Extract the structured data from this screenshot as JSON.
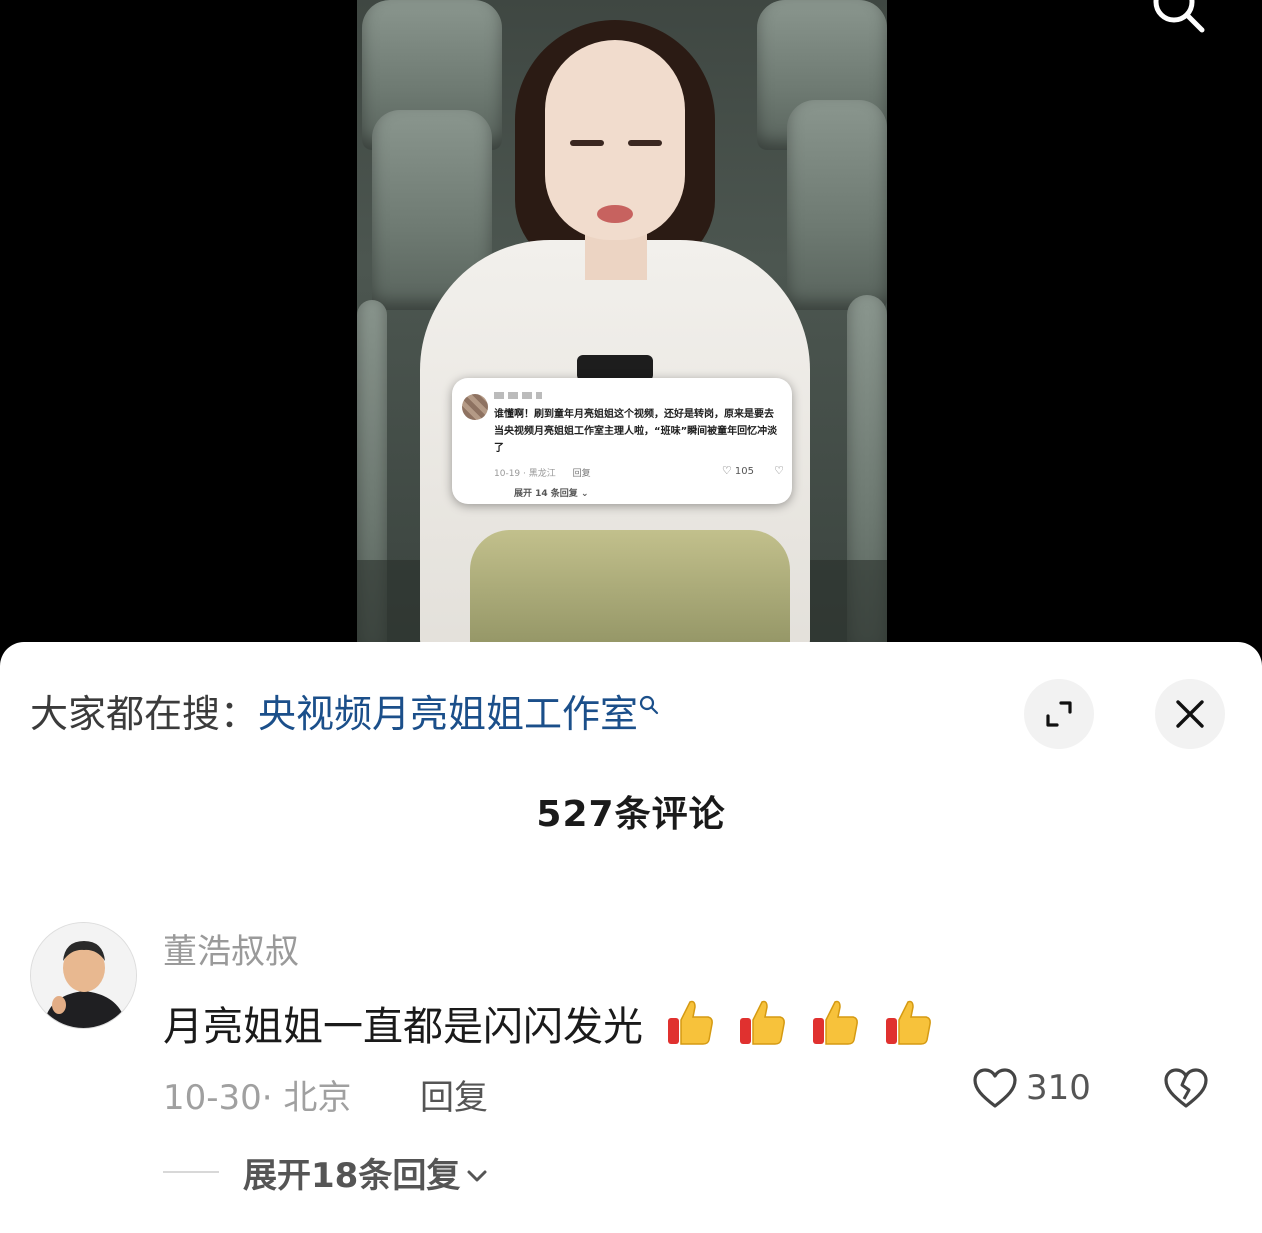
{
  "video": {
    "embedded_comment": {
      "text": "谁懂啊！刷到童年月亮姐姐这个视频，还好是转岗，原来是要去当央视频月亮姐姐工作室主理人啦，“班味”瞬间被童年回忆冲淡了",
      "date_location": "10-19 · 黑龙江",
      "reply_label": "回复",
      "like_count": "105",
      "expand_label": "展开 14 条回复"
    }
  },
  "sheet": {
    "search_prefix": "大家都在搜：",
    "search_term": "央视频月亮姐姐工作室",
    "comment_count": "527条评论"
  },
  "comment": {
    "author": "董浩叔叔",
    "text": "月亮姐姐一直都是闪闪发光",
    "date": "10-30",
    "location": "· 北京",
    "reply_label": "回复",
    "like_count": "310",
    "expand_replies": "展开18条回复"
  },
  "icons": [
    "search-icon",
    "expand-icon",
    "close-icon",
    "heart-icon",
    "broken-heart-icon",
    "thumbs-up-icon",
    "chevron-down-icon"
  ]
}
